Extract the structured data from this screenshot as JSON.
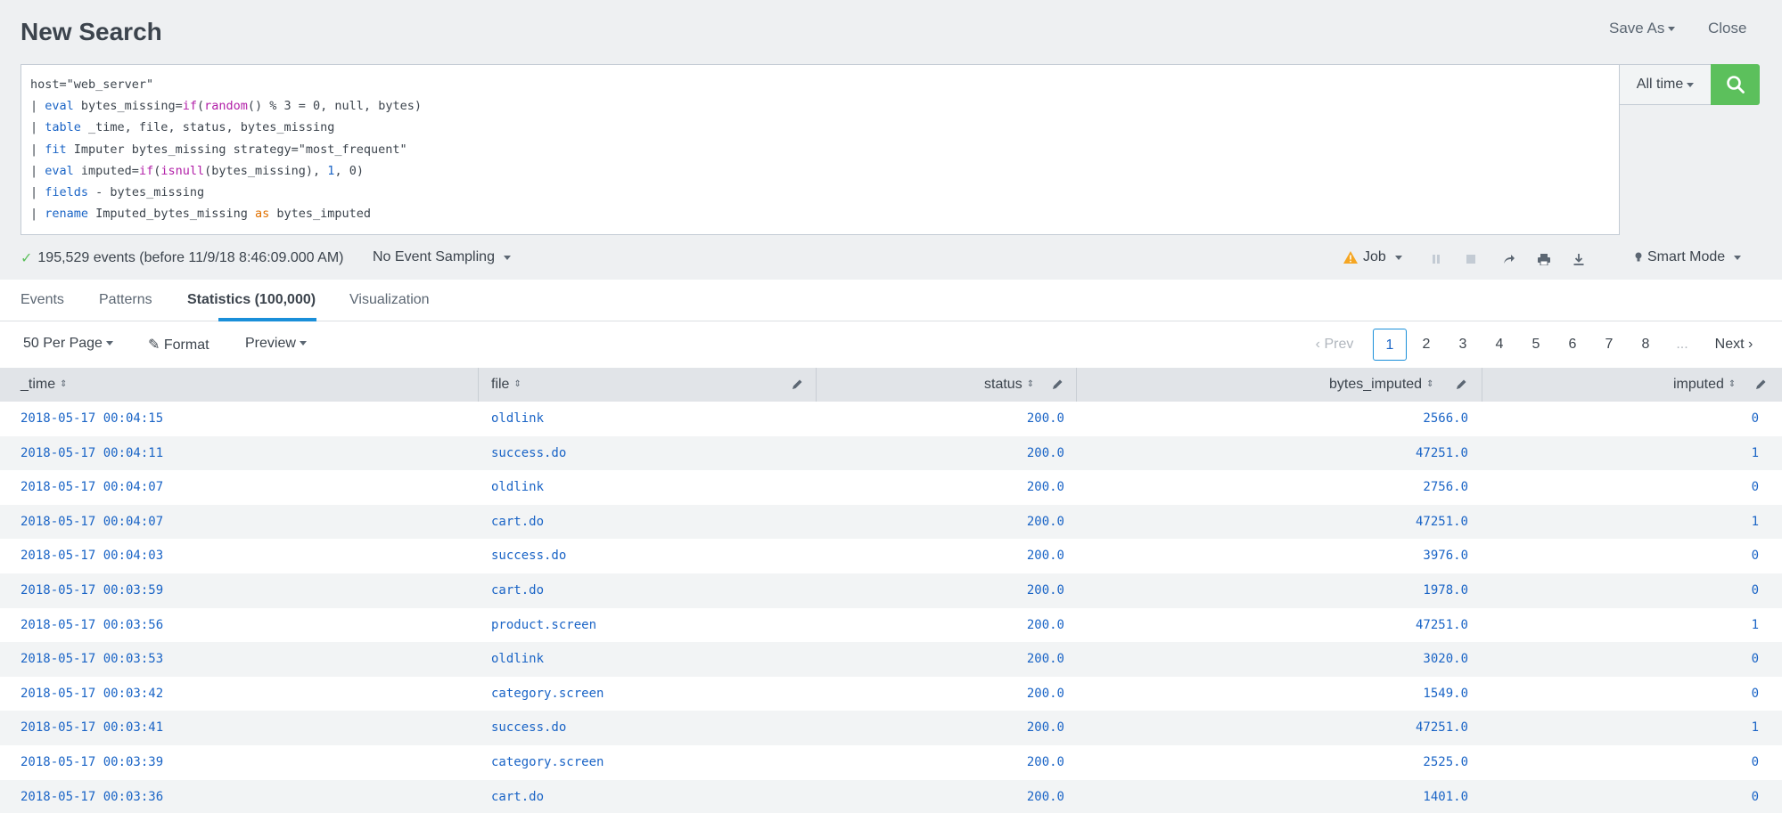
{
  "header": {
    "title": "New Search",
    "save_as": "Save As",
    "close": "Close"
  },
  "search": {
    "time_range": "All time"
  },
  "status": {
    "events_summary": "195,529 events (before 11/9/18 8:46:09.000 AM)",
    "sampling": "No Event Sampling",
    "job": "Job",
    "mode": "Smart Mode"
  },
  "tabs": [
    {
      "label": "Events"
    },
    {
      "label": "Patterns"
    },
    {
      "label": "Statistics (100,000)"
    },
    {
      "label": "Visualization"
    }
  ],
  "controls": {
    "per_page": "50 Per Page",
    "format": "Format",
    "preview": "Preview"
  },
  "pagination": {
    "prev": "Prev",
    "pages": [
      "1",
      "2",
      "3",
      "4",
      "5",
      "6",
      "7",
      "8"
    ],
    "ellipsis": "...",
    "next": "Next"
  },
  "table": {
    "columns": [
      "_time",
      "file",
      "status",
      "bytes_imputed",
      "imputed"
    ],
    "rows": [
      [
        "2018-05-17 00:04:15",
        "oldlink",
        "200.0",
        "2566.0",
        "0"
      ],
      [
        "2018-05-17 00:04:11",
        "success.do",
        "200.0",
        "47251.0",
        "1"
      ],
      [
        "2018-05-17 00:04:07",
        "oldlink",
        "200.0",
        "2756.0",
        "0"
      ],
      [
        "2018-05-17 00:04:07",
        "cart.do",
        "200.0",
        "47251.0",
        "1"
      ],
      [
        "2018-05-17 00:04:03",
        "success.do",
        "200.0",
        "3976.0",
        "0"
      ],
      [
        "2018-05-17 00:03:59",
        "cart.do",
        "200.0",
        "1978.0",
        "0"
      ],
      [
        "2018-05-17 00:03:56",
        "product.screen",
        "200.0",
        "47251.0",
        "1"
      ],
      [
        "2018-05-17 00:03:53",
        "oldlink",
        "200.0",
        "3020.0",
        "0"
      ],
      [
        "2018-05-17 00:03:42",
        "category.screen",
        "200.0",
        "1549.0",
        "0"
      ],
      [
        "2018-05-17 00:03:41",
        "success.do",
        "200.0",
        "47251.0",
        "1"
      ],
      [
        "2018-05-17 00:03:39",
        "category.screen",
        "200.0",
        "2525.0",
        "0"
      ],
      [
        "2018-05-17 00:03:36",
        "cart.do",
        "200.0",
        "1401.0",
        "0"
      ]
    ]
  },
  "colors": {
    "accent": "#1a8fd9",
    "search_button": "#5cc05c",
    "link": "#1a64c6"
  }
}
